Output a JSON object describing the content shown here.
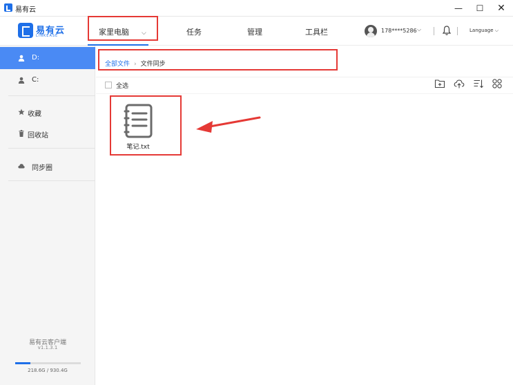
{
  "window": {
    "title": "易有云"
  },
  "brand": {
    "name": "易有云",
    "sub": "LINKEASE",
    "color": "#1e6fe8"
  },
  "nav": {
    "home": "家里电脑",
    "task": "任务",
    "manage": "管理",
    "tools": "工具栏"
  },
  "user": {
    "phone": "178****5286",
    "language": "Language"
  },
  "sidebar": {
    "drives": [
      {
        "label": "D:",
        "active": true
      },
      {
        "label": "C:",
        "active": false
      }
    ],
    "favorites": "收藏",
    "trash": "回收站",
    "sync": "同步圈",
    "version_name": "易有云客户端",
    "version": "v1.1.3.1",
    "storage": {
      "used_text": "218.6G / 930.4G",
      "used_fraction": 0.235
    }
  },
  "main": {
    "breadcrumb": {
      "root": "全部文件",
      "current": "文件同步"
    },
    "select_all": "全选",
    "files": [
      {
        "name": "笔记.txt",
        "type": "text"
      }
    ]
  },
  "colors": {
    "accent": "#4a8af4",
    "annotation": "#e53935"
  }
}
